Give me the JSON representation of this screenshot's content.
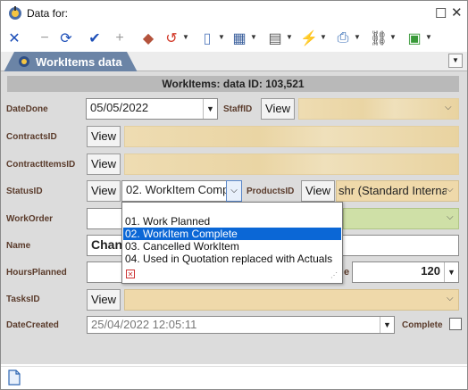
{
  "window": {
    "title": "Data for:"
  },
  "toolbar": {
    "items": [
      {
        "name": "close",
        "glyph": "✕",
        "color": "#1d4fb8"
      },
      {
        "name": "minus",
        "glyph": "−",
        "color": "#9a9a9a"
      },
      {
        "name": "refresh",
        "glyph": "⟳",
        "color": "#1d4fb8"
      },
      {
        "name": "check",
        "glyph": "✔",
        "color": "#1d4fb8"
      },
      {
        "name": "plus",
        "glyph": "+",
        "color": "#9a9a9a"
      },
      {
        "name": "eraser",
        "glyph": "◆",
        "color": "#b4533c"
      },
      {
        "name": "undo",
        "glyph": "↺",
        "color": "#d23a2a"
      },
      {
        "name": "document",
        "glyph": "▯",
        "color": "#5a7fc0"
      },
      {
        "name": "grid",
        "glyph": "▦",
        "color": "#3a5f9c"
      },
      {
        "name": "form",
        "glyph": "▤",
        "color": "#555"
      },
      {
        "name": "lightning",
        "glyph": "⚡",
        "color": "#e1b600"
      },
      {
        "name": "print",
        "glyph": "⎙",
        "color": "#2f67b3"
      },
      {
        "name": "link",
        "glyph": "⛓",
        "color": "#333"
      },
      {
        "name": "image",
        "glyph": "▣",
        "color": "#3a9a3a"
      }
    ]
  },
  "tab": {
    "label": "WorkItems data"
  },
  "header": {
    "text": "WorkItems: data ID: 103,521"
  },
  "fields": {
    "date_done": {
      "label": "DateDone",
      "value": "05/05/2022"
    },
    "staff_id": {
      "label": "StaffID",
      "button": "View"
    },
    "contracts_id": {
      "label": "ContractsID",
      "button": "View"
    },
    "contract_items_id": {
      "label": "ContractItemsID",
      "button": "View"
    },
    "status_id": {
      "label": "StatusID",
      "button": "View",
      "value": "02. WorkItem Comp"
    },
    "products_id": {
      "label": "ProductsID",
      "button": "View",
      "value": "shr (Standard Interna"
    },
    "work_order": {
      "label": "WorkOrder"
    },
    "name": {
      "label": "Name",
      "value": "Chang"
    },
    "hours_planned": {
      "label": "HoursPlanned",
      "value": "120",
      "partial_label": "e"
    },
    "tasks_id": {
      "label": "TasksID",
      "button": "View"
    },
    "date_created": {
      "label": "DateCreated",
      "value": "25/04/2022 12:05:11"
    },
    "complete": {
      "label": "Complete"
    }
  },
  "status_dropdown": {
    "options": [
      "01. Work Planned",
      "02. WorkItem Complete",
      "03. Cancelled WorkItem",
      "04. Used in Quotation replaced with Actuals"
    ],
    "selected_index": 1
  }
}
